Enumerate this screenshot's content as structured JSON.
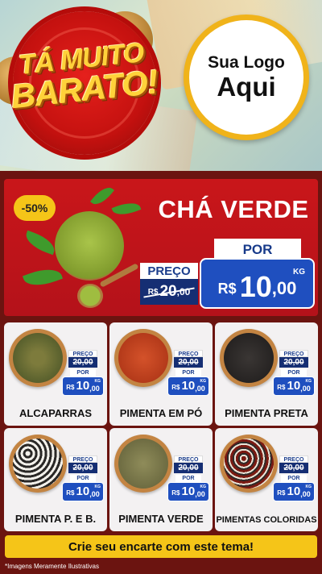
{
  "header": {
    "slogan_line1": "TÁ MUITO",
    "slogan_line2": "BARATO!",
    "logo_line1": "Sua Logo",
    "logo_line2": "Aqui"
  },
  "featured": {
    "discount": "-50%",
    "name": "CHÁ VERDE",
    "old_label": "PREÇO",
    "old_currency": "R$",
    "old_int": "20",
    "old_dec": ",00",
    "new_label": "POR",
    "new_currency": "R$",
    "new_int": "10",
    "new_dec": ",00",
    "unit": "KG"
  },
  "products": [
    {
      "name": "ALCAPARRAS",
      "old_label": "PREÇO",
      "old_price": "20,00",
      "new_label": "POR",
      "currency": "R$",
      "int": "10",
      "dec": ",00",
      "unit": "KG"
    },
    {
      "name": "PIMENTA EM PÓ",
      "old_label": "PREÇO",
      "old_price": "20,00",
      "new_label": "POR",
      "currency": "R$",
      "int": "10",
      "dec": ",00",
      "unit": "KG"
    },
    {
      "name": "PIMENTA PRETA",
      "old_label": "PREÇO",
      "old_price": "20,00",
      "new_label": "POR",
      "currency": "R$",
      "int": "10",
      "dec": ",00",
      "unit": "KG"
    },
    {
      "name": "PIMENTA P. E B.",
      "old_label": "PREÇO",
      "old_price": "20,00",
      "new_label": "POR",
      "currency": "R$",
      "int": "10",
      "dec": ",00",
      "unit": "KG"
    },
    {
      "name": "PIMENTA VERDE",
      "old_label": "PREÇO",
      "old_price": "20,00",
      "new_label": "POR",
      "currency": "R$",
      "int": "10",
      "dec": ",00",
      "unit": "KG"
    },
    {
      "name": "PIMENTAS COLORIDAS",
      "old_label": "PREÇO",
      "old_price": "20,00",
      "new_label": "POR",
      "currency": "R$",
      "int": "10",
      "dec": ",00",
      "unit": "KG"
    }
  ],
  "cta": "Crie seu encarte com este tema!",
  "disclaimer": "*Imagens Meramente Ilustrativas",
  "colors": {
    "red": "#c9161a",
    "yellow": "#f5c518",
    "blue": "#1f4fbf",
    "dark_blue": "#152e73"
  }
}
